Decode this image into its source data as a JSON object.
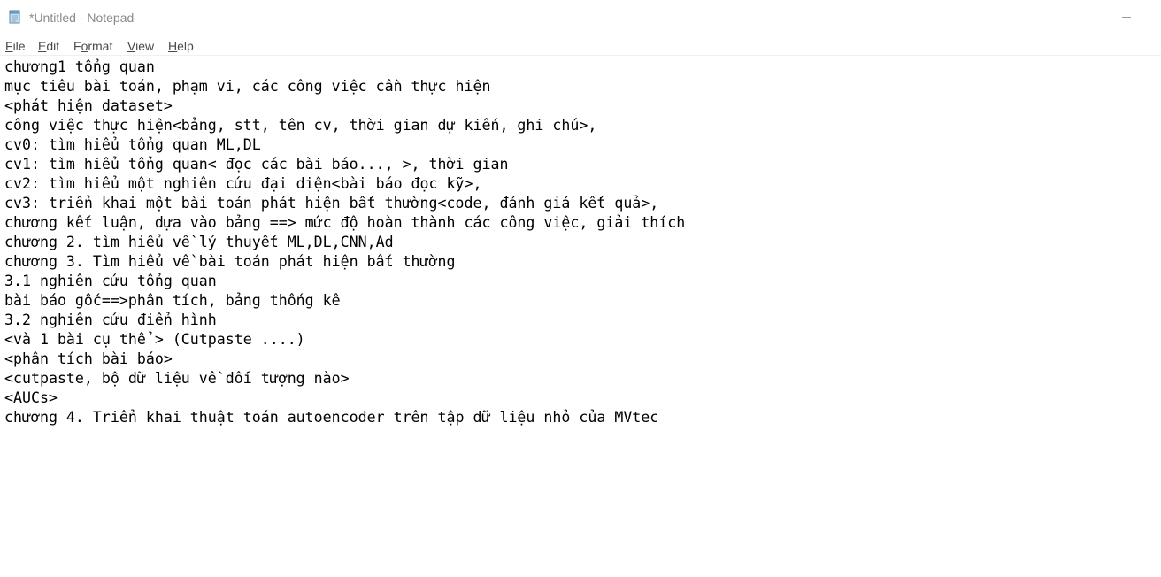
{
  "window": {
    "title": "*Untitled - Notepad",
    "app_icon": "notepad-icon",
    "minimize_icon": "minimize-icon"
  },
  "menu": {
    "file": {
      "label": "File",
      "underline": "F",
      "rest": "ile"
    },
    "edit": {
      "label": "Edit",
      "underline": "E",
      "rest": "dit"
    },
    "format": {
      "label": "Format",
      "pre": "F",
      "underline": "o",
      "rest": "rmat"
    },
    "view": {
      "label": "View",
      "underline": "V",
      "rest": "iew"
    },
    "help": {
      "label": "Help",
      "underline": "H",
      "rest": "elp"
    }
  },
  "editor": {
    "lines": [
      "chương1 tổng quan",
      "mục tiêu bài toán, phạm vi, các công việc cần thực hiện",
      "<phát hiện dataset>",
      "công việc thực hiện<bảng, stt, tên cv, thời gian dự kiến, ghi chú>,",
      "cv0: tìm hiểu tổng quan ML,DL",
      "cv1: tìm hiểu tổng quan< đọc các bài báo..., >, thời gian",
      "cv2: tìm hiểu một nghiên cứu đại diện<bài báo đọc kỹ>,",
      "cv3: triển khai một bài toán phát hiện bất thường<code, đánh giá kết quả>,",
      "chương kết luận, dựa vào bảng ==> mức độ hoàn thành các công việc, giải thích",
      "chương 2. tìm hiểu về lý thuyết ML,DL,CNN,Ad",
      "chương 3. Tìm hiểu về bài toán phát hiện bất thường",
      "3.1 nghiên cứu tổng quan",
      "bài báo gốc==>phân tích, bảng thống kê",
      "3.2 nghiên cứu điển hình",
      "<và 1 bài cụ thể > (Cutpaste ....)",
      "<phân tích bài báo>",
      "<cutpaste, bộ dữ liệu về dối tượng nào>",
      "<AUCs>",
      "chương 4. Triển khai thuật toán autoencoder trên tập dữ liệu nhỏ của MVtec"
    ]
  }
}
